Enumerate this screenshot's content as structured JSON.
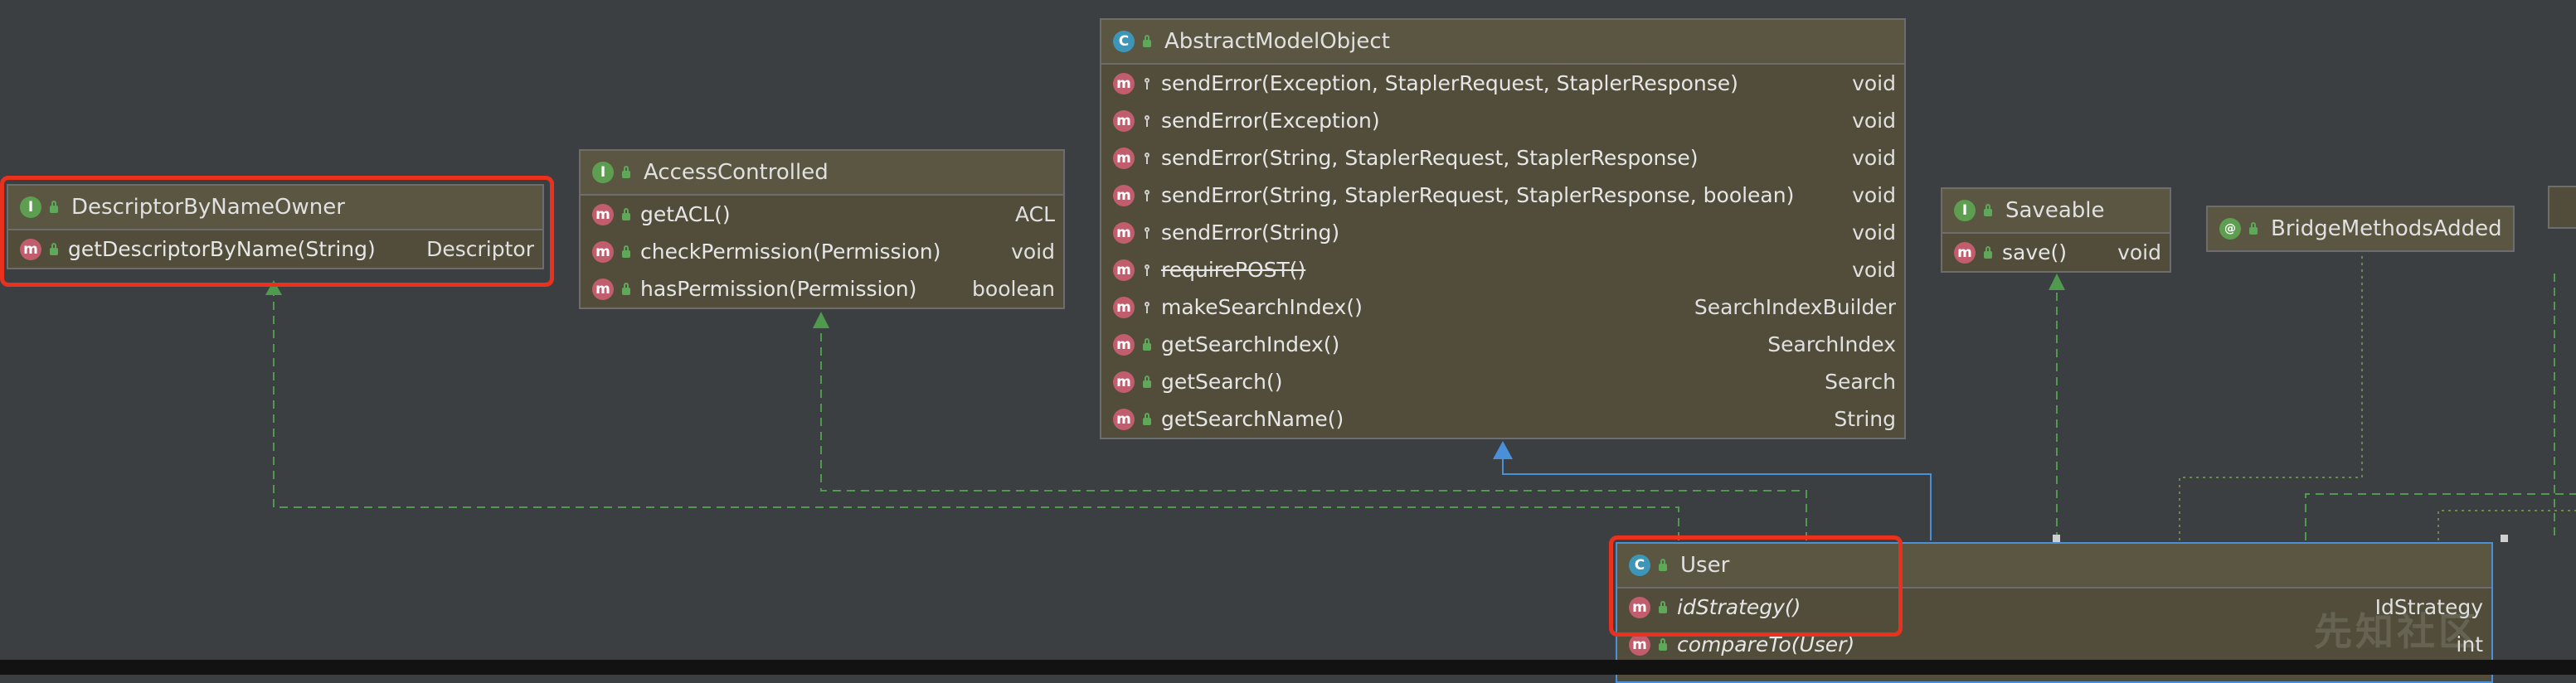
{
  "colors": {
    "background": "#3c3f41",
    "box_fill": "#514d3a",
    "header_fill": "#5a5641",
    "interface_arrow": "#4f9a4f",
    "superclass_arrow": "#4a90d9",
    "highlight": "#e8321e"
  },
  "nodes": {
    "descriptor_by_name_owner": {
      "kind_badge": "I",
      "title": "DescriptorByNameOwner",
      "members": [
        {
          "name": "getDescriptorByName(String)",
          "ret": "Descriptor"
        }
      ]
    },
    "access_controlled": {
      "kind_badge": "I",
      "title": "AccessControlled",
      "members": [
        {
          "name": "getACL()",
          "ret": "ACL"
        },
        {
          "name": "checkPermission(Permission)",
          "ret": "void"
        },
        {
          "name": "hasPermission(Permission)",
          "ret": "boolean"
        }
      ]
    },
    "abstract_model_object": {
      "kind_badge": "C",
      "title": "AbstractModelObject",
      "members": [
        {
          "name": "sendError(Exception, StaplerRequest, StaplerResponse)",
          "ret": "void"
        },
        {
          "name": "sendError(Exception)",
          "ret": "void"
        },
        {
          "name": "sendError(String, StaplerRequest, StaplerResponse)",
          "ret": "void"
        },
        {
          "name": "sendError(String, StaplerRequest, StaplerResponse, boolean)",
          "ret": "void"
        },
        {
          "name": "sendError(String)",
          "ret": "void"
        },
        {
          "name": "requirePOST()",
          "ret": "void"
        },
        {
          "name": "makeSearchIndex()",
          "ret": "SearchIndexBuilder"
        },
        {
          "name": "getSearchIndex()",
          "ret": "SearchIndex"
        },
        {
          "name": "getSearch()",
          "ret": "Search"
        },
        {
          "name": "getSearchName()",
          "ret": "String"
        }
      ]
    },
    "saveable": {
      "kind_badge": "I",
      "title": "Saveable",
      "members": [
        {
          "name": "save()",
          "ret": "void"
        }
      ]
    },
    "bridge_methods_added": {
      "kind_badge": "@",
      "title": "BridgeMethodsAdded",
      "members": []
    },
    "user": {
      "kind_badge": "C",
      "title": "User",
      "members": [
        {
          "name": "idStrategy()",
          "ret": "IdStrategy"
        },
        {
          "name": "compareTo(User)",
          "ret": "int"
        }
      ]
    }
  },
  "method_badge": "m",
  "watermark": "先知社区"
}
